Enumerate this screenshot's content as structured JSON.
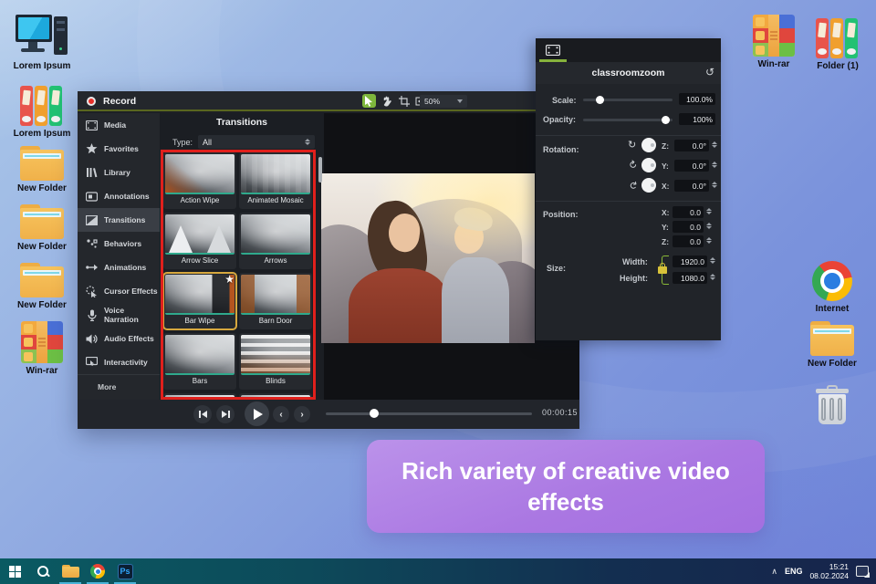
{
  "desktop": {
    "icons_left": [
      {
        "label": "Lorem Ipsum",
        "icon": "computer-icon"
      },
      {
        "label": "Lorem Ipsum",
        "icon": "binders-icon"
      },
      {
        "label": "New Folder",
        "icon": "folder-icon"
      },
      {
        "label": "New Folder",
        "icon": "folder-icon"
      },
      {
        "label": "New Folder",
        "icon": "folder-icon"
      },
      {
        "label": "Win-rar",
        "icon": "winrar-icon"
      }
    ],
    "icons_top_right": [
      {
        "label": "Win-rar",
        "icon": "winrar-icon"
      },
      {
        "label": "Folder (1)",
        "icon": "binders-icon"
      }
    ],
    "icons_right": [
      {
        "label": "Internet",
        "icon": "chrome-icon"
      },
      {
        "label": "New Folder",
        "icon": "folder-icon"
      }
    ]
  },
  "record_window": {
    "title": "Record",
    "toolbar": {
      "zoom_level": "50%"
    },
    "sidebar": {
      "items": [
        {
          "label": "Media"
        },
        {
          "label": "Favorites"
        },
        {
          "label": "Library"
        },
        {
          "label": "Annotations"
        },
        {
          "label": "Transitions"
        },
        {
          "label": "Behaviors"
        },
        {
          "label": "Animations"
        },
        {
          "label": "Cursor Effects"
        },
        {
          "label": "Voice Narration"
        },
        {
          "label": "Audio Effects"
        },
        {
          "label": "Interactivity"
        },
        {
          "label": "More"
        }
      ],
      "active_item": "Transitions"
    },
    "transitions_panel": {
      "title": "Transitions",
      "type_label": "Type:",
      "type_value": "All",
      "items": [
        "Action Wipe",
        "Animated Mosaic",
        "Arrow Slice",
        "Arrows",
        "Bar Wipe",
        "Barn Door",
        "Bars",
        "Blinds"
      ],
      "selected_item": "Bar Wipe"
    },
    "playback": {
      "time": "00:00:15"
    }
  },
  "properties_panel": {
    "title": "classroomzoom",
    "scale_label": "Scale:",
    "scale_value": "100.0%",
    "opacity_label": "Opacity:",
    "opacity_value": "100%",
    "rotation_label": "Rotation:",
    "rotation_rows": [
      {
        "axis": "Z:",
        "value": "0.0°"
      },
      {
        "axis": "Y:",
        "value": "0.0°"
      },
      {
        "axis": "X:",
        "value": "0.0°"
      }
    ],
    "position_label": "Position:",
    "position_rows": [
      {
        "axis": "X:",
        "value": "0.0"
      },
      {
        "axis": "Y:",
        "value": "0.0"
      },
      {
        "axis": "Z:",
        "value": "0.0"
      }
    ],
    "size_label": "Size:",
    "width_label": "Width:",
    "width_value": "1920.0",
    "height_label": "Height:",
    "height_value": "1080.0"
  },
  "banner": {
    "text": "Rich variety of creative video effects"
  },
  "taskbar": {
    "language": "ENG",
    "time": "15:21",
    "date": "08.02.2024"
  },
  "colors": {
    "accent_green": "#86b23c",
    "teal_underline": "#2fa98c",
    "selection_yellow": "#d7a83e",
    "red_highlight": "#e0201c",
    "banner_purple": "#a97ae3"
  }
}
